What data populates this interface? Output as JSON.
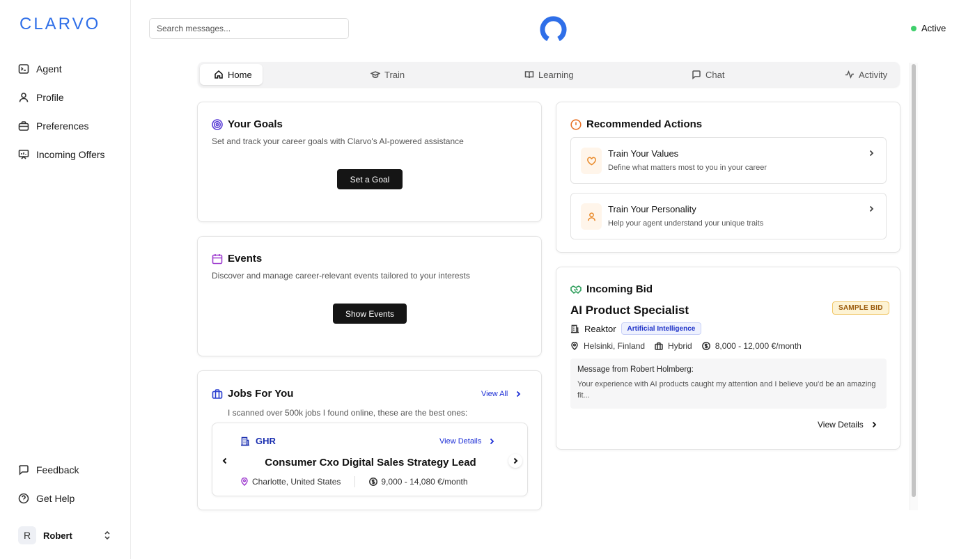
{
  "app": {
    "logo_text": "CLARVO"
  },
  "sidebar": {
    "items": [
      {
        "label": "Agent",
        "icon": "terminal-icon"
      },
      {
        "label": "Profile",
        "icon": "user-icon"
      },
      {
        "label": "Preferences",
        "icon": "briefcase-icon"
      },
      {
        "label": "Incoming Offers",
        "icon": "presentation-icon"
      }
    ],
    "bottom_items": [
      {
        "label": "Feedback",
        "icon": "message-icon"
      },
      {
        "label": "Get Help",
        "icon": "help-icon"
      }
    ],
    "user": {
      "initial": "R",
      "name": "Robert"
    }
  },
  "header": {
    "search_placeholder": "Search messages...",
    "status_label": "Active",
    "status_color": "#3ecf6b",
    "brand_color": "#2f6fe8"
  },
  "tabs": [
    {
      "label": "Home",
      "icon": "home-icon",
      "active": true
    },
    {
      "label": "Train",
      "icon": "graduation-cap-icon",
      "active": false
    },
    {
      "label": "Learning",
      "icon": "book-open-icon",
      "active": false
    },
    {
      "label": "Chat",
      "icon": "chat-icon",
      "active": false
    },
    {
      "label": "Activity",
      "icon": "activity-icon",
      "active": false
    }
  ],
  "goals": {
    "title": "Your Goals",
    "description": "Set and track your career goals with Clarvo's AI-powered assistance",
    "button": "Set a Goal",
    "icon_color": "#5b3fd6"
  },
  "events": {
    "title": "Events",
    "description": "Discover and manage career-relevant events tailored to your interests",
    "button": "Show Events",
    "icon_color": "#a040d0"
  },
  "jobs": {
    "title": "Jobs For You",
    "view_all": "View All",
    "subtitle": "I scanned over 500k jobs I found online, these are the best ones:",
    "job": {
      "company": "GHR",
      "view_details": "View Details",
      "title": "Consumer Cxo Digital Sales Strategy Lead",
      "location": "Charlotte, United States",
      "salary": "9,000 - 14,080 €/month"
    },
    "icon_color": "#2a3fd0"
  },
  "recommended": {
    "title": "Recommended Actions",
    "icon_color": "#e8742a",
    "items": [
      {
        "title": "Train Your Values",
        "description": "Define what matters most to you in your career",
        "icon": "heart-icon"
      },
      {
        "title": "Train Your Personality",
        "description": "Help your agent understand your unique traits",
        "icon": "person-icon"
      }
    ]
  },
  "bid": {
    "title": "Incoming Bid",
    "icon_color": "#2e9e5b",
    "role": "AI Product Specialist",
    "badge": "SAMPLE BID",
    "company": "Reaktor",
    "industry": "Artificial Intelligence",
    "location": "Helsinki, Finland",
    "work_mode": "Hybrid",
    "salary": "8,000 - 12,000 €/month",
    "message_from": "Message from Robert Holmberg:",
    "message": "Your experience with AI products caught my attention and I believe you'd be an amazing fit...",
    "view_details": "View Details"
  }
}
